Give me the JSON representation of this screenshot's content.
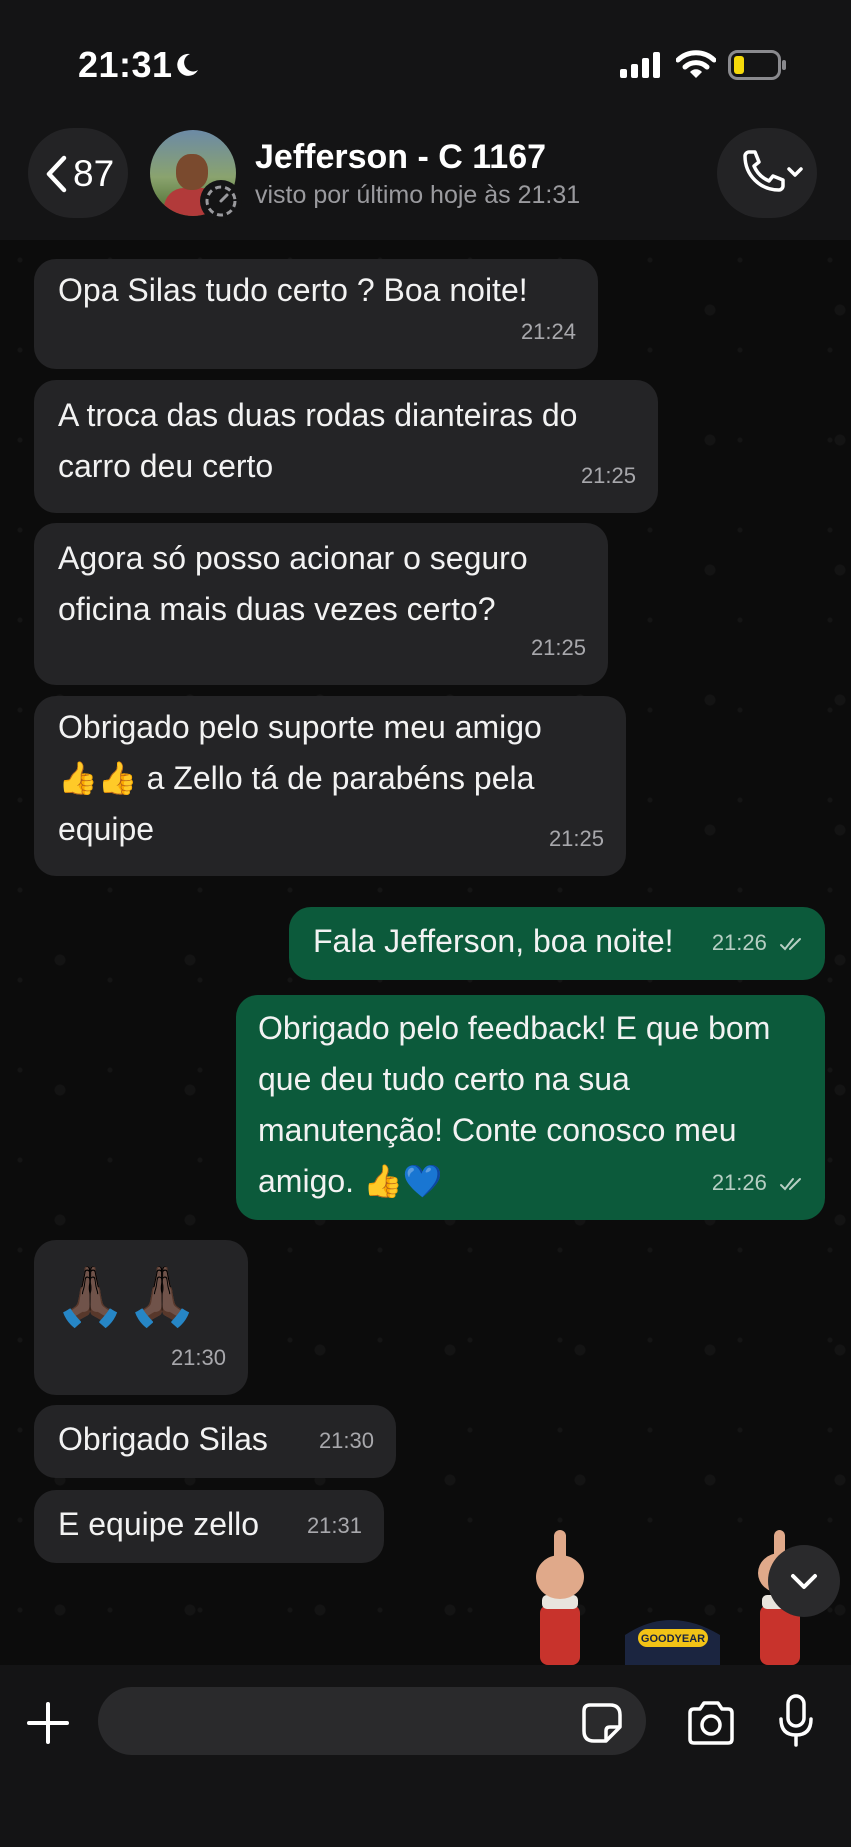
{
  "status_bar": {
    "time": "21:31"
  },
  "header": {
    "back_count": "87",
    "contact_name": "Jefferson - C 1167",
    "last_seen": "visto por último hoje às 21:31"
  },
  "messages": [
    {
      "direction": "in",
      "text": "Opa Silas tudo certo ? Boa noite!",
      "time": "21:24"
    },
    {
      "direction": "in",
      "text": "A troca das duas rodas dianteiras do\ncarro deu certo",
      "time": "21:25"
    },
    {
      "direction": "in",
      "text": "Agora só posso acionar o seguro\noficina mais duas vezes certo?",
      "time": "21:25"
    },
    {
      "direction": "in",
      "text": "Obrigado pelo suporte meu amigo\n👍👍 a Zello tá de parabéns pela\nequipe",
      "time": "21:25"
    },
    {
      "direction": "out",
      "text": "Fala Jefferson, boa noite!",
      "time": "21:26"
    },
    {
      "direction": "out",
      "text": "Obrigado pelo feedback! E que bom\nque deu tudo certo na sua\nmanutenção! Conte conosco meu\namigo. 👍💙",
      "time": "21:26"
    },
    {
      "direction": "in",
      "text": "🙏🏿🙏🏿",
      "time": "21:30"
    },
    {
      "direction": "in",
      "text": "Obrigado Silas",
      "time": "21:30"
    },
    {
      "direction": "in",
      "text": "E equipe zello",
      "time": "21:31"
    }
  ],
  "sticker": {
    "cap_text": "GOODYEAR"
  },
  "input": {
    "placeholder": ""
  },
  "colors": {
    "incoming_bubble": "#242426",
    "outgoing_bubble": "#0c5a3b",
    "background": "#0c0c0c"
  }
}
